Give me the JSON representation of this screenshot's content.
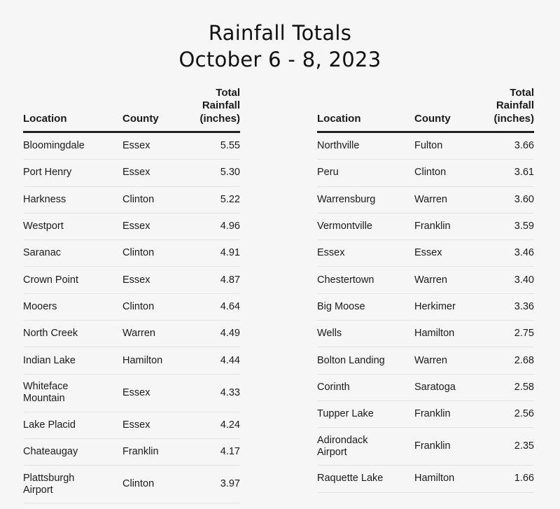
{
  "title_line1": "Rainfall Totals",
  "title_line2": "October 6 - 8, 2023",
  "headers": {
    "location": "Location",
    "county": "County",
    "total": "Total Rainfall (inches)"
  },
  "chart_data": {
    "type": "table",
    "title": "Rainfall Totals October 6 - 8, 2023",
    "columns": [
      "Location",
      "County",
      "Total Rainfall (inches)"
    ],
    "left_rows": [
      {
        "location": "Bloomingdale",
        "county": "Essex",
        "total": "5.55"
      },
      {
        "location": "Port Henry",
        "county": "Essex",
        "total": "5.30"
      },
      {
        "location": "Harkness",
        "county": "Clinton",
        "total": "5.22"
      },
      {
        "location": "Westport",
        "county": "Essex",
        "total": "4.96"
      },
      {
        "location": "Saranac",
        "county": "Clinton",
        "total": "4.91"
      },
      {
        "location": "Crown Point",
        "county": "Essex",
        "total": "4.87"
      },
      {
        "location": "Mooers",
        "county": "Clinton",
        "total": "4.64"
      },
      {
        "location": "North Creek",
        "county": "Warren",
        "total": "4.49"
      },
      {
        "location": "Indian Lake",
        "county": "Hamilton",
        "total": "4.44"
      },
      {
        "location": "Whiteface Mountain",
        "county": "Essex",
        "total": "4.33"
      },
      {
        "location": "Lake Placid",
        "county": "Essex",
        "total": "4.24"
      },
      {
        "location": "Chateaugay",
        "county": "Franklin",
        "total": "4.17"
      },
      {
        "location": "Plattsburgh Airport",
        "county": "Clinton",
        "total": "3.97"
      }
    ],
    "right_rows": [
      {
        "location": "Northville",
        "county": "Fulton",
        "total": "3.66"
      },
      {
        "location": "Peru",
        "county": "Clinton",
        "total": "3.61"
      },
      {
        "location": "Warrensburg",
        "county": "Warren",
        "total": "3.60"
      },
      {
        "location": "Vermontville",
        "county": "Franklin",
        "total": "3.59"
      },
      {
        "location": "Essex",
        "county": "Essex",
        "total": "3.46"
      },
      {
        "location": "Chestertown",
        "county": "Warren",
        "total": "3.40"
      },
      {
        "location": "Big Moose",
        "county": "Herkimer",
        "total": "3.36"
      },
      {
        "location": "Wells",
        "county": "Hamilton",
        "total": "2.75"
      },
      {
        "location": "Bolton Landing",
        "county": "Warren",
        "total": "2.68"
      },
      {
        "location": "Corinth",
        "county": "Saratoga",
        "total": "2.58"
      },
      {
        "location": "Tupper Lake",
        "county": "Franklin",
        "total": "2.56"
      },
      {
        "location": "Adirondack Airport",
        "county": "Franklin",
        "total": "2.35"
      },
      {
        "location": "Raquette Lake",
        "county": "Hamilton",
        "total": "1.66"
      }
    ]
  }
}
